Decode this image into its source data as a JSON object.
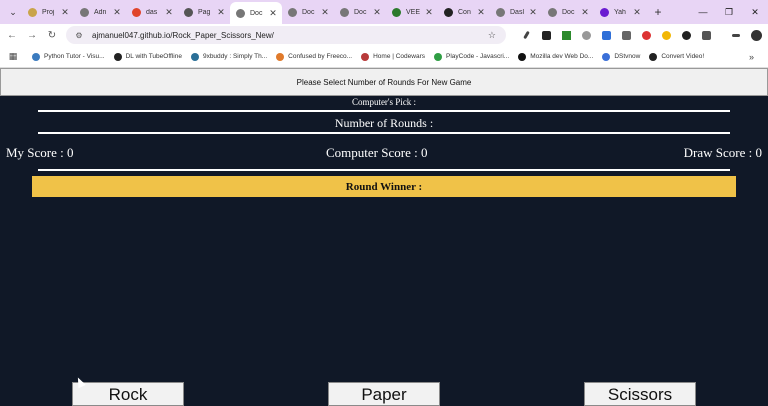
{
  "browser": {
    "tabs": [
      {
        "label": "Proj",
        "color": "#c9a44a"
      },
      {
        "label": "Adn",
        "color": "#777777"
      },
      {
        "label": "das",
        "color": "#e0442b"
      },
      {
        "label": "Pag",
        "color": "#555555"
      },
      {
        "label": "Doc",
        "color": "#777777",
        "active": true
      },
      {
        "label": "Doc",
        "color": "#777777"
      },
      {
        "label": "Doc",
        "color": "#777777"
      },
      {
        "label": "VEE",
        "color": "#2c7a2c"
      },
      {
        "label": "Con",
        "color": "#222222"
      },
      {
        "label": "Dasl",
        "color": "#777777"
      },
      {
        "label": "Doc",
        "color": "#777777"
      },
      {
        "label": "Yah",
        "color": "#6a1bd1"
      }
    ],
    "new_tab": "+",
    "url": "ajmanuel047.github.io/Rock_Paper_Scissors_New/",
    "bookmarks": [
      {
        "label": "Python Tutor - Visu...",
        "color": "#3b7bbf"
      },
      {
        "label": "DL with TubeOffline",
        "color": "#222222"
      },
      {
        "label": "9xbuddy : Simply Th...",
        "color": "#2a6f97"
      },
      {
        "label": "Confused by Freeco...",
        "color": "#e07a2b"
      },
      {
        "label": "Home | Codewars",
        "color": "#b83a3a"
      },
      {
        "label": "PlayCode - Javascri...",
        "color": "#2f9e44"
      },
      {
        "label": "Mozilla dev Web Do...",
        "color": "#111111"
      },
      {
        "label": "DStvnow",
        "color": "#3a6fd8"
      },
      {
        "label": "Convert Video!",
        "color": "#222222"
      }
    ]
  },
  "game": {
    "notice": "Please Select Number of Rounds For New Game",
    "computer_pick": "Computer's Pick :",
    "rounds": "Number of Rounds :",
    "my_score": "My Score : 0",
    "computer_score": "Computer Score : 0",
    "draw_score": "Draw Score : 0",
    "round_winner": "Round Winner :",
    "buttons": {
      "rock": "Rock",
      "paper": "Paper",
      "scissors": "Scissors"
    }
  },
  "colors": {
    "background": "#101827",
    "winner_bar": "#f0c248"
  }
}
